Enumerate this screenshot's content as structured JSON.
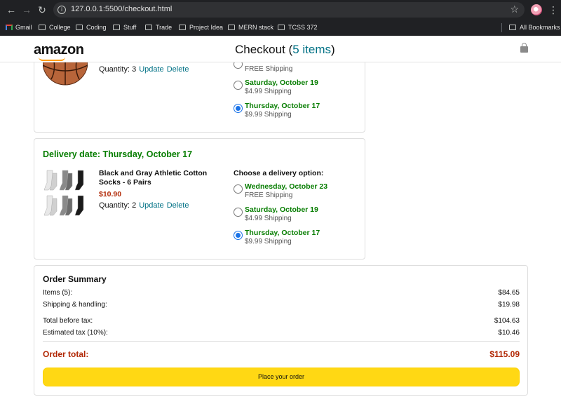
{
  "browser": {
    "url": "127.0.0.1:5500/checkout.html",
    "bookmarks": [
      "Gmail",
      "College",
      "Coding",
      "Stuff",
      "Trade",
      "Project Idea",
      "MERN stack",
      "TCSS 372"
    ],
    "all_bookmarks": "All Bookmarks"
  },
  "header": {
    "logo": "amazon",
    "title_prefix": "Checkout (",
    "items_link": "5 items",
    "title_suffix": ")"
  },
  "item1": {
    "partial_shipping": "FREE Shipping",
    "quantity": "Quantity: 3",
    "update": "Update",
    "delete": "Delete",
    "options": [
      {
        "date": "Saturday, October 19",
        "shipping": "$4.99 Shipping",
        "selected": false
      },
      {
        "date": "Thursday, October 17",
        "shipping": "$9.99 Shipping",
        "selected": true
      }
    ]
  },
  "item2": {
    "delivery_date": "Delivery date: Thursday, October 17",
    "name": "Black and Gray Athletic Cotton Socks - 6 Pairs",
    "price": "$10.90",
    "quantity": "Quantity: 2",
    "update": "Update",
    "delete": "Delete",
    "choose_label": "Choose a delivery option:",
    "options": [
      {
        "date": "Wednesday, October 23",
        "shipping": "FREE Shipping",
        "selected": false
      },
      {
        "date": "Saturday, October 19",
        "shipping": "$4.99 Shipping",
        "selected": false
      },
      {
        "date": "Thursday, October 17",
        "shipping": "$9.99 Shipping",
        "selected": true
      }
    ]
  },
  "summary": {
    "title": "Order Summary",
    "rows": [
      {
        "label": "Items (5):",
        "value": "$84.65"
      },
      {
        "label": "Shipping & handling:",
        "value": "$19.98"
      },
      {
        "label": "Total before tax:",
        "value": "$104.63"
      },
      {
        "label": "Estimated tax (10%):",
        "value": "$10.46"
      }
    ],
    "total_label": "Order total:",
    "total_value": "$115.09",
    "button": "Place your order"
  },
  "colors": {
    "delivery_green": "#067d00",
    "price_red": "#b12704",
    "link_teal": "#017185",
    "button_yellow": "#ffd814"
  }
}
